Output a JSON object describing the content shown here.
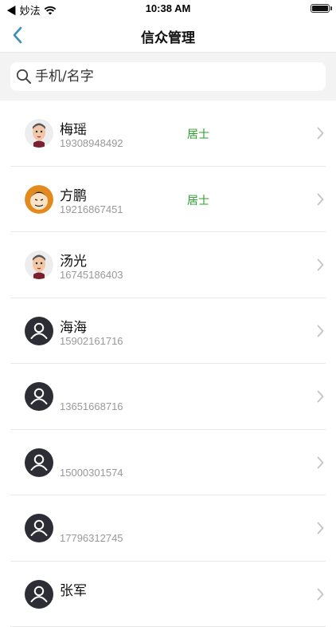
{
  "status_bar": {
    "back_app": "◀ 妙法",
    "time": "10:38 AM"
  },
  "nav": {
    "title": "信众管理"
  },
  "search": {
    "placeholder": "手机/名字"
  },
  "colors": {
    "tag_green": "#2aa22a",
    "back_arrow": "#3b8fb8",
    "default_avatar_bg": "#2d2d35"
  },
  "members": [
    {
      "name": "梅瑶",
      "phone": "19308948492",
      "tag": "居士",
      "avatar": "cartoon-face-icon"
    },
    {
      "name": "方鹏",
      "phone": "19216867451",
      "tag": "居士",
      "avatar": "cartoon-face-icon"
    },
    {
      "name": "汤光",
      "phone": "16745186403",
      "tag": "",
      "avatar": "cartoon-face-icon"
    },
    {
      "name": "海海",
      "phone": "15902161716",
      "tag": "",
      "avatar": "default-person-icon"
    },
    {
      "name": "",
      "phone": "13651668716",
      "tag": "",
      "avatar": "default-person-icon"
    },
    {
      "name": "",
      "phone": "15000301574",
      "tag": "",
      "avatar": "default-person-icon"
    },
    {
      "name": "",
      "phone": "17796312745",
      "tag": "",
      "avatar": "default-person-icon"
    },
    {
      "name": "张军",
      "phone": "",
      "tag": "",
      "avatar": "default-person-icon"
    }
  ]
}
